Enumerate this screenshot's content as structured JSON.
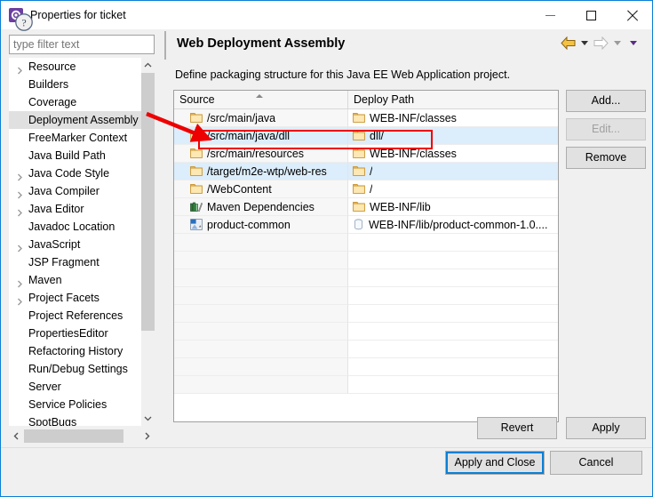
{
  "window": {
    "title": "Properties for ticket",
    "icon": "eclipse-properties-icon",
    "minimize_label": "Minimize",
    "maximize_label": "Maximize",
    "close_label": "Close"
  },
  "filter": {
    "placeholder": "type filter text",
    "value": ""
  },
  "tree": {
    "items": [
      {
        "label": "Resource",
        "expandable": true,
        "selected": false
      },
      {
        "label": "Builders",
        "expandable": false,
        "selected": false
      },
      {
        "label": "Coverage",
        "expandable": false,
        "selected": false
      },
      {
        "label": "Deployment Assembly",
        "expandable": false,
        "selected": true
      },
      {
        "label": "FreeMarker Context",
        "expandable": false,
        "selected": false
      },
      {
        "label": "Java Build Path",
        "expandable": false,
        "selected": false
      },
      {
        "label": "Java Code Style",
        "expandable": true,
        "selected": false
      },
      {
        "label": "Java Compiler",
        "expandable": true,
        "selected": false
      },
      {
        "label": "Java Editor",
        "expandable": true,
        "selected": false
      },
      {
        "label": "Javadoc Location",
        "expandable": false,
        "selected": false
      },
      {
        "label": "JavaScript",
        "expandable": true,
        "selected": false
      },
      {
        "label": "JSP Fragment",
        "expandable": false,
        "selected": false
      },
      {
        "label": "Maven",
        "expandable": true,
        "selected": false
      },
      {
        "label": "Project Facets",
        "expandable": true,
        "selected": false
      },
      {
        "label": "Project References",
        "expandable": false,
        "selected": false
      },
      {
        "label": "PropertiesEditor",
        "expandable": false,
        "selected": false
      },
      {
        "label": "Refactoring History",
        "expandable": false,
        "selected": false
      },
      {
        "label": "Run/Debug Settings",
        "expandable": false,
        "selected": false
      },
      {
        "label": "Server",
        "expandable": false,
        "selected": false
      },
      {
        "label": "Service Policies",
        "expandable": false,
        "selected": false
      },
      {
        "label": "SpotBugs",
        "expandable": false,
        "selected": false
      }
    ]
  },
  "page": {
    "title": "Web Deployment Assembly",
    "description": "Define packaging structure for this Java EE Web Application project.",
    "nav": {
      "back_icon": "back-arrow-icon",
      "back_menu_icon": "chevron-down-icon",
      "forward_icon": "forward-arrow-icon",
      "forward_menu_icon": "chevron-down-icon",
      "view_menu_icon": "chevron-down-icon"
    }
  },
  "table": {
    "columns": [
      {
        "key": "source",
        "label": "Source",
        "sorted": true,
        "sort_icon": "sort-asc-icon"
      },
      {
        "key": "deploy",
        "label": "Deploy Path",
        "sorted": false
      }
    ],
    "rows": [
      {
        "icon": "folder-icon",
        "source": "/src/main/java",
        "deploy_icon": "folder-icon",
        "deploy": "WEB-INF/classes",
        "highlighted": false
      },
      {
        "icon": "folder-icon",
        "source": "/src/main/java/dll",
        "deploy_icon": "folder-icon",
        "deploy": "dll/",
        "highlighted": true
      },
      {
        "icon": "folder-icon",
        "source": "/src/main/resources",
        "deploy_icon": "folder-icon",
        "deploy": "WEB-INF/classes",
        "highlighted": false
      },
      {
        "icon": "folder-icon",
        "source": "/target/m2e-wtp/web-res",
        "deploy_icon": "folder-icon",
        "deploy": "/",
        "highlighted": true
      },
      {
        "icon": "folder-icon",
        "source": "/WebContent",
        "deploy_icon": "folder-icon",
        "deploy": "/",
        "highlighted": false
      },
      {
        "icon": "library-icon",
        "source": "Maven Dependencies",
        "deploy_icon": "folder-icon",
        "deploy": "WEB-INF/lib",
        "highlighted": false
      },
      {
        "icon": "project-icon",
        "source": "product-common",
        "deploy_icon": "jar-icon",
        "deploy": "WEB-INF/lib/product-common-1.0....",
        "highlighted": false
      }
    ],
    "empty_row_count": 9
  },
  "buttons": {
    "add": "Add...",
    "edit": "Edit...",
    "edit_enabled": false,
    "remove": "Remove",
    "revert": "Revert",
    "apply": "Apply",
    "apply_and_close": "Apply and Close",
    "cancel": "Cancel"
  },
  "footer": {
    "help_icon": "help-question-icon"
  },
  "annotation": {
    "color": "#ee0000",
    "arrow_icon": "red-arrow-pointer",
    "highlight_box": "red-rectangle-highlight"
  }
}
